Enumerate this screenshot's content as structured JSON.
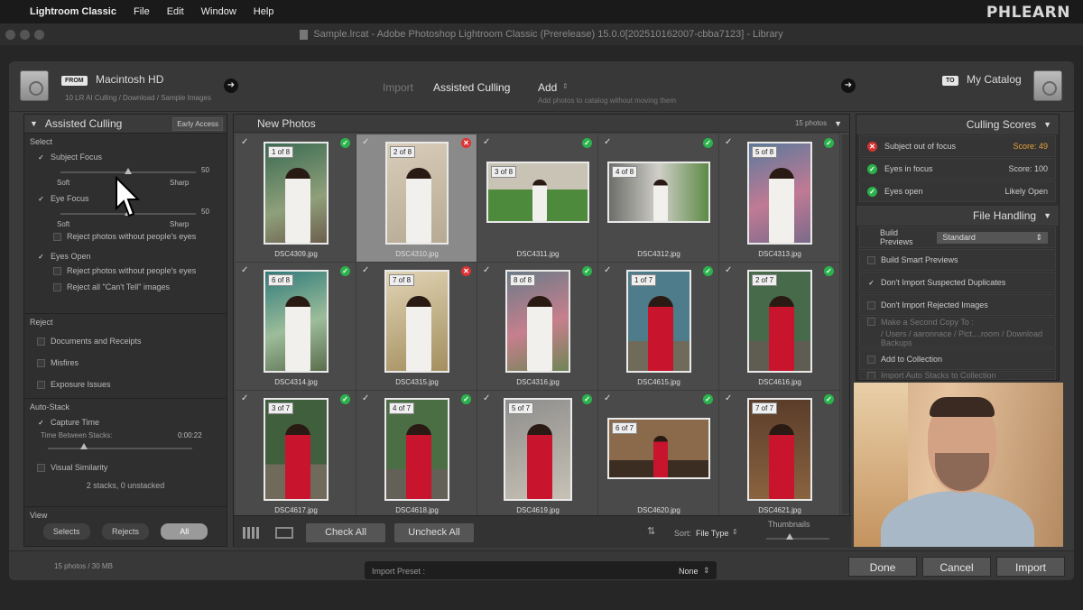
{
  "menubar": {
    "app": "Lightroom Classic",
    "items": [
      "File",
      "Edit",
      "Window",
      "Help"
    ],
    "brand": "PHLEARN"
  },
  "titlebar": {
    "title": "Sample.lrcat - Adobe Photoshop Lightroom Classic (Prerelease) 15.0.0[202510162007-cbba7123] - Library"
  },
  "source": {
    "tag": "FROM",
    "name": "Macintosh HD",
    "path": "10 LR AI Culling / Download / Sample Images"
  },
  "modes": {
    "import": "Import",
    "culling": "Assisted Culling",
    "add": "Add",
    "add_desc": "Add photos to catalog without moving them"
  },
  "destination": {
    "tag": "TO",
    "name": "My Catalog"
  },
  "left_panel": {
    "title": "Assisted Culling",
    "badge": "Early Access",
    "select": {
      "title": "Select",
      "subject_focus": {
        "label": "Subject Focus",
        "value": "50",
        "min": "Soft",
        "max": "Sharp",
        "level": 0.5
      },
      "eye_focus": {
        "label": "Eye Focus",
        "value": "50",
        "min": "Soft",
        "max": "Sharp",
        "level": 0.5,
        "reject": "Reject photos without people's eyes"
      },
      "eyes_open": {
        "label": "Eyes Open",
        "reject1": "Reject photos without people's eyes",
        "reject2": "Reject all \"Can't Tell\" images"
      }
    },
    "reject": {
      "title": "Reject",
      "items": [
        "Documents and Receipts",
        "Misfires",
        "Exposure Issues"
      ]
    },
    "autostack": {
      "title": "Auto-Stack",
      "capture": "Capture Time",
      "between": "Time Between Stacks:",
      "time": "0:00:22",
      "level": 0.25,
      "similarity": "Visual Similarity",
      "summary": "2 stacks, 0 unstacked"
    },
    "view": {
      "title": "View",
      "options": [
        "Selects",
        "Rejects",
        "All"
      ]
    },
    "footer": "15 photos / 30 MB"
  },
  "grid": {
    "title": "New Photos",
    "count": "15 photos",
    "photos": [
      {
        "name": "DSC4309.jpg",
        "label": "1 of 8",
        "status": "ok"
      },
      {
        "name": "DSC4310.jpg",
        "label": "2 of 8",
        "status": "bad"
      },
      {
        "name": "DSC4311.jpg",
        "label": "3 of 8",
        "status": "ok"
      },
      {
        "name": "DSC4312.jpg",
        "label": "4 of 8",
        "status": "ok"
      },
      {
        "name": "DSC4313.jpg",
        "label": "5 of 8",
        "status": "ok"
      },
      {
        "name": "DSC4314.jpg",
        "label": "6 of 8",
        "status": "ok"
      },
      {
        "name": "DSC4315.jpg",
        "label": "7 of 8",
        "status": "bad"
      },
      {
        "name": "DSC4316.jpg",
        "label": "8 of 8",
        "status": "ok"
      },
      {
        "name": "DSC4615.jpg",
        "label": "1 of 7",
        "status": "ok"
      },
      {
        "name": "DSC4616.jpg",
        "label": "2 of 7",
        "status": "ok"
      },
      {
        "name": "DSC4617.jpg",
        "label": "3 of 7",
        "status": "ok"
      },
      {
        "name": "DSC4618.jpg",
        "label": "4 of 7",
        "status": "ok"
      },
      {
        "name": "DSC4619.jpg",
        "label": "5 of 7",
        "status": "ok"
      },
      {
        "name": "DSC4620.jpg",
        "label": "6 of 7",
        "status": "ok"
      },
      {
        "name": "DSC4621.jpg",
        "label": "7 of 7",
        "status": "ok"
      }
    ],
    "footer": {
      "check_all": "Check All",
      "uncheck_all": "Uncheck All",
      "sort_label": "Sort:",
      "sort_value": "File Type",
      "thumbnails": "Thumbnails"
    }
  },
  "right_panel": {
    "culling_title": "Culling Scores",
    "scores": [
      {
        "label": "Subject out of focus",
        "score": "Score: 49",
        "status": "bad"
      },
      {
        "label": "Eyes in focus",
        "score": "Score: 100",
        "status": "ok"
      },
      {
        "label": "Eyes open",
        "score": "Likely Open",
        "status": "ok"
      }
    ],
    "file_title": "File Handling",
    "build_previews": "Build Previews",
    "previews_value": "Standard",
    "options": [
      "Build Smart Previews",
      "Don't Import Suspected Duplicates",
      "Don't Import Rejected Images"
    ],
    "second_copy": "Make a Second Copy To :",
    "second_path": "/ Users / aaronnace / Pict....room / Download Backups",
    "collection": "Add to Collection",
    "autostack_cut": "Import Auto Stacks to Collection"
  },
  "bottom": {
    "preset_label": "Import Preset :",
    "preset_value": "None",
    "done": "Done",
    "cancel": "Cancel",
    "import": "Import"
  },
  "colors": {
    "ok": "#2bb24c",
    "bad": "#d33333"
  }
}
